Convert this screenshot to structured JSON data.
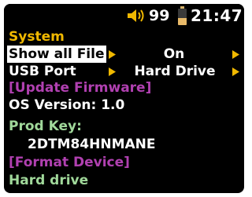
{
  "status_bar": {
    "volume": "99",
    "battery_level": 0.45,
    "time": "21:47",
    "speaker_icon": "speaker-icon",
    "battery_icon": "battery-icon"
  },
  "menu": {
    "title": "System",
    "settings": [
      {
        "label": "Show all File",
        "value": "On",
        "selected": true
      },
      {
        "label": "USB Port",
        "value": "Hard Drive",
        "selected": false
      }
    ],
    "update_firmware": "[Update Firmware]",
    "os_version": "OS Version: 1.0",
    "prod_key_label": "Prod Key:",
    "prod_key_value": "2DTM84HNMANE",
    "format_device": "[Format Device]",
    "format_target": "Hard drive"
  },
  "colors": {
    "background": "#000000",
    "accent": "#f0b800",
    "action": "#b040b0",
    "info": "#a0d89a",
    "text": "#ffffff"
  }
}
